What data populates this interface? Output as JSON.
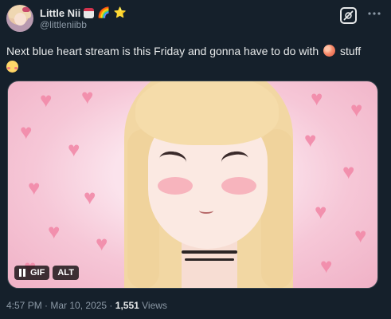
{
  "author": {
    "display_name": "Little Nii",
    "handle": "@littleniibb",
    "name_emojis": [
      "📛",
      "🌈",
      "⭐"
    ]
  },
  "tweet": {
    "text_before_peach": "Next blue heart stream is this Friday and gonna have to do with ",
    "peach_emoji": "🍑",
    "text_after_peach": " stuff",
    "flushed_emoji": "😳"
  },
  "media": {
    "type_badge": "GIF",
    "alt_badge": "ALT",
    "pause_icon": "pause-icon"
  },
  "meta": {
    "time": "4:57 PM",
    "separator": " · ",
    "date": "Mar 10, 2025",
    "views_count": "1,551",
    "views_label": " Views"
  },
  "icons": {
    "grok": "grok-icon",
    "more": "more-icon"
  },
  "colors": {
    "background": "#15202b",
    "text_primary": "#e7e9ea",
    "text_secondary": "#8b98a5"
  }
}
